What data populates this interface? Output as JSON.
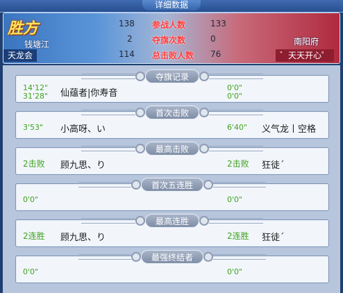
{
  "window": {
    "title": "详细数据"
  },
  "scoreboard": {
    "result": "胜方",
    "left_server": "钱塘江",
    "left_guild": "天龙会",
    "right_server": "南阳府",
    "right_guild": "゛天天开心゜",
    "stats": [
      {
        "label": "参战人数",
        "left": "138",
        "right": "133"
      },
      {
        "label": "夺旗次数",
        "left": "2",
        "right": "0"
      },
      {
        "label": "总击败人数",
        "left": "114",
        "right": "76"
      }
    ]
  },
  "sections": [
    {
      "title": "夺旗记录",
      "left_value": "14'12\"",
      "left_value2": "31'28\"",
      "left_name": "仙蕴者|你寿音",
      "right_value": "0'0\"",
      "right_value2": "0'0\"",
      "right_name": ""
    },
    {
      "title": "首次击败",
      "left_value": "3'53\"",
      "left_name": "小高呀、い",
      "right_value": "6'40\"",
      "right_name": "义气龙丨空格"
    },
    {
      "title": "最高击败",
      "left_value": "2击败",
      "left_name": "顾九思、り",
      "right_value": "2击败",
      "right_name": "狂徒´"
    },
    {
      "title": "首次五连胜",
      "left_value": "0'0\"",
      "left_name": "",
      "right_value": "0'0\"",
      "right_name": ""
    },
    {
      "title": "最高连胜",
      "left_value": "2连胜",
      "left_name": "顾九思、り",
      "right_value": "2连胜",
      "right_name": "狂徒´"
    },
    {
      "title": "最强终结者",
      "left_value": "0'0\"",
      "left_name": "",
      "right_value": "0'0\"",
      "right_name": ""
    }
  ]
}
